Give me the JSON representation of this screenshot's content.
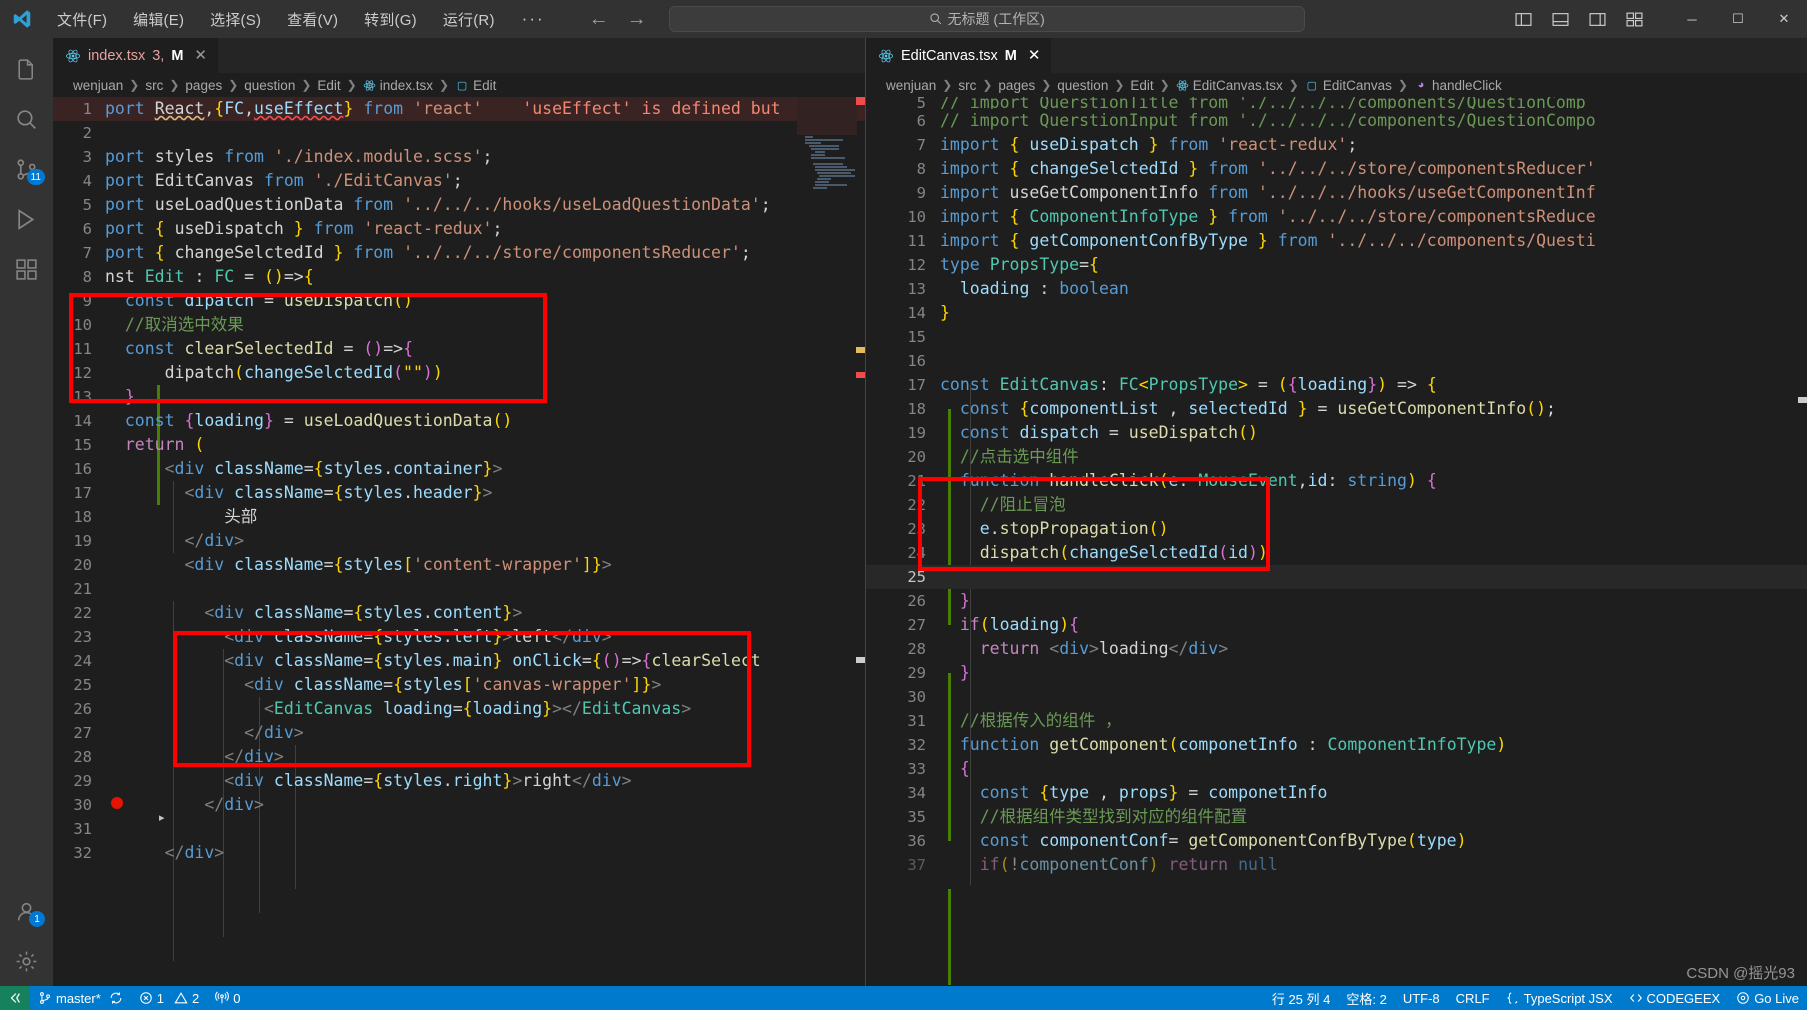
{
  "titlebar": {
    "logo_icon": "vscode-logo",
    "menus": [
      "文件(F)",
      "编辑(E)",
      "选择(S)",
      "查看(V)",
      "转到(G)",
      "运行(R)"
    ],
    "more": "···",
    "back_icon": "arrow-left-icon",
    "forward_icon": "arrow-right-icon",
    "command_center": {
      "text": "无标题 (工作区)",
      "icon": "search-icon"
    },
    "layout_icons": [
      "panel-left-icon",
      "panel-bottom-icon",
      "panel-right-icon",
      "layout-grid-icon"
    ],
    "window_controls": {
      "minimize": "─",
      "maximize": "☐",
      "close": "✕"
    }
  },
  "activitybar": {
    "items": [
      {
        "name": "explorer",
        "icon": "files-icon",
        "badge": ""
      },
      {
        "name": "search",
        "icon": "search-icon",
        "badge": ""
      },
      {
        "name": "source-control",
        "icon": "source-control-icon",
        "badge": "11"
      },
      {
        "name": "run-debug",
        "icon": "debug-icon",
        "badge": ""
      },
      {
        "name": "extensions",
        "icon": "extensions-icon",
        "badge": ""
      }
    ],
    "bottom": [
      {
        "name": "accounts",
        "icon": "account-icon",
        "badge": "1"
      },
      {
        "name": "settings",
        "icon": "gear-icon",
        "badge": ""
      }
    ]
  },
  "left_group": {
    "tab": {
      "icon": "react-icon",
      "filename": "index.tsx",
      "meta": "3,",
      "modified": "M",
      "close_icon": "close-icon"
    },
    "tabs_actions_icon": "more-actions-icon",
    "breadcrumb": [
      "wenjuan",
      "src",
      "pages",
      "question",
      "Edit",
      "index.tsx",
      "Edit"
    ],
    "breadcrumb_icons": {
      "index.tsx": "react-icon",
      "Edit": "symbol-variable-icon"
    },
    "inline_error": "'useEffect' is defined but",
    "lines": [
      {
        "n": "1",
        "code": "port React,{FC,useEffect} from 'react'"
      },
      {
        "n": "2",
        "code": ""
      },
      {
        "n": "3",
        "code": "port styles from './index.module.scss';"
      },
      {
        "n": "4",
        "code": "port EditCanvas from './EditCanvas';"
      },
      {
        "n": "5",
        "code": "port useLoadQuestionData from '../../../hooks/useLoadQuestionData';"
      },
      {
        "n": "6",
        "code": "port { useDispatch } from 'react-redux';"
      },
      {
        "n": "7",
        "code": "port { changeSelctedId } from '../../../store/componentsReducer';"
      },
      {
        "n": "8",
        "code": "nst Edit : FC = ()=>{"
      },
      {
        "n": "9",
        "code": "  const dipatch = useDispatch()"
      },
      {
        "n": "10",
        "code": "  //取消选中效果"
      },
      {
        "n": "11",
        "code": "  const clearSelectedId = ()=>{"
      },
      {
        "n": "12",
        "code": "      dipatch(changeSelctedId(\"\"))"
      },
      {
        "n": "13",
        "code": "  }"
      },
      {
        "n": "14",
        "code": "  const {loading} = useLoadQuestionData()"
      },
      {
        "n": "15",
        "code": "  return ("
      },
      {
        "n": "16",
        "code": "      <div className={styles.container}>"
      },
      {
        "n": "17",
        "code": "        <div className={styles.header}>"
      },
      {
        "n": "18",
        "code": "            头部"
      },
      {
        "n": "19",
        "code": "        </div>"
      },
      {
        "n": "20",
        "code": "        <div className={styles['content-wrapper']}>"
      },
      {
        "n": "21",
        "code": ""
      },
      {
        "n": "22",
        "code": "          <div className={styles.content}>"
      },
      {
        "n": "23",
        "code": "            <div className={styles.left}>left</div>"
      },
      {
        "n": "24",
        "code": "            <div className={styles.main} onClick={()=>{clearSelect"
      },
      {
        "n": "25",
        "code": "              <div className={styles['canvas-wrapper']}>"
      },
      {
        "n": "26",
        "code": "                <EditCanvas loading={loading}></EditCanvas>"
      },
      {
        "n": "27",
        "code": "              </div>"
      },
      {
        "n": "28",
        "code": "            </div>"
      },
      {
        "n": "29",
        "code": "            <div className={styles.right}>right</div>"
      },
      {
        "n": "30",
        "code": "          </div>"
      },
      {
        "n": "31",
        "code": ""
      },
      {
        "n": "32",
        "code": "      </div>"
      }
    ]
  },
  "right_group": {
    "tab": {
      "icon": "react-icon",
      "filename": "EditCanvas.tsx",
      "modified": "M",
      "close_icon": "close-icon"
    },
    "tabs_actions_icon": "more-actions-icon",
    "breadcrumb": [
      "wenjuan",
      "src",
      "pages",
      "question",
      "Edit",
      "EditCanvas.tsx",
      "EditCanvas",
      "handleClick"
    ],
    "lines": [
      {
        "n": "5",
        "code": "// import QuerstionTitle from './../../../components/QuestionComp"
      },
      {
        "n": "6",
        "code": "// import QuerstionInput from './../../../components/QuestionCompo"
      },
      {
        "n": "7",
        "code": "import { useDispatch } from 'react-redux';"
      },
      {
        "n": "8",
        "code": "import { changeSelctedId } from '../../../store/componentsReducer'"
      },
      {
        "n": "9",
        "code": "import useGetComponentInfo from '../../../hooks/useGetComponentInf"
      },
      {
        "n": "10",
        "code": "import { ComponentInfoType } from '../../../store/componentsReduce"
      },
      {
        "n": "11",
        "code": "import { getComponentConfByType } from '../../../components/Questi"
      },
      {
        "n": "12",
        "code": "type PropsType={"
      },
      {
        "n": "13",
        "code": "  loading : boolean"
      },
      {
        "n": "14",
        "code": "}"
      },
      {
        "n": "15",
        "code": ""
      },
      {
        "n": "16",
        "code": ""
      },
      {
        "n": "17",
        "code": "const EditCanvas: FC<PropsType> = ({loading}) => {"
      },
      {
        "n": "18",
        "code": "  const {componentList , selectedId } = useGetComponentInfo();"
      },
      {
        "n": "19",
        "code": "  const dispatch = useDispatch()"
      },
      {
        "n": "20",
        "code": "  //点击选中组件"
      },
      {
        "n": "21",
        "code": "  function handleClick(e: MouseEvent,id: string) {"
      },
      {
        "n": "22",
        "code": "    //阻止冒泡"
      },
      {
        "n": "23",
        "code": "    e.stopPropagation()"
      },
      {
        "n": "24",
        "code": "    dispatch(changeSelctedId(id))"
      },
      {
        "n": "25",
        "code": ""
      },
      {
        "n": "26",
        "code": "  }"
      },
      {
        "n": "27",
        "code": "  if(loading){"
      },
      {
        "n": "28",
        "code": "    return <div>loading</div>"
      },
      {
        "n": "29",
        "code": "  }"
      },
      {
        "n": "30",
        "code": ""
      },
      {
        "n": "31",
        "code": "  //根据传入的组件 ，"
      },
      {
        "n": "32",
        "code": "  function getComponent(componetInfo : ComponentInfoType)"
      },
      {
        "n": "33",
        "code": "  {"
      },
      {
        "n": "34",
        "code": "    const {type , props} = componetInfo"
      },
      {
        "n": "35",
        "code": "    //根据组件类型找到对应的组件配置"
      },
      {
        "n": "36",
        "code": "    const componentConf= getComponentConfByType(type)"
      },
      {
        "n": "37",
        "code": "    if(!componentConf) return null"
      }
    ]
  },
  "statusbar": {
    "remote_icon": "remote-window-icon",
    "branch": {
      "icon": "source-control-icon",
      "label": "master*",
      "sync_icon": "sync-icon"
    },
    "problems": {
      "error_icon": "error-icon",
      "errors": "1",
      "warning_icon": "warning-icon",
      "warnings": "2"
    },
    "ports": {
      "icon": "radio-tower-icon",
      "count": "0"
    },
    "right": {
      "cursor": "行 25   列 4",
      "spaces": "空格: 2",
      "encoding": "UTF-8",
      "eol": "CRLF",
      "language": "TypeScript JSX",
      "language_icon": "braces-icon",
      "codegeex": "CODEGEEX",
      "codegeex_icon": "code-icon",
      "golive": "Go Live",
      "golive_icon": "broadcast-icon"
    }
  },
  "watermark": "CSDN @摇光93",
  "annotations": {
    "boxes": [
      {
        "name": "clear-selected-id-highlight",
        "pane": "left"
      },
      {
        "name": "main-div-onclick-highlight",
        "pane": "left"
      },
      {
        "name": "stop-propagation-highlight",
        "pane": "right"
      }
    ],
    "color": "#ff0000"
  }
}
